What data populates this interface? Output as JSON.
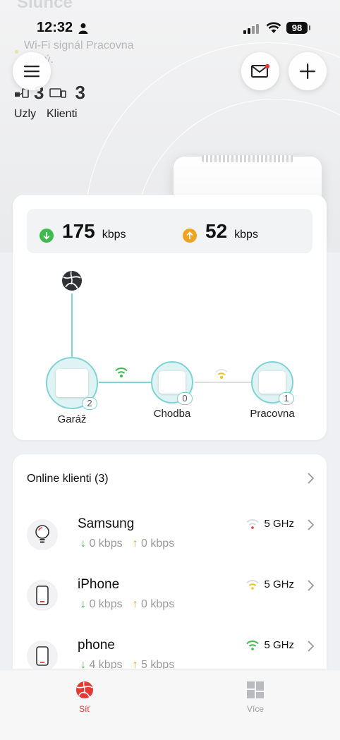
{
  "status_bar": {
    "time": "12:32",
    "battery": "98"
  },
  "header": {
    "title": "Slunce",
    "warning": "Wi-Fi signál Pracovna slabý.",
    "nodes_count": "3",
    "clients_count": "3",
    "nodes_label": "Uzly",
    "clients_label": "Klienti"
  },
  "speed": {
    "down_value": "175",
    "down_unit": "kbps",
    "up_value": "52",
    "up_unit": "kbps"
  },
  "topology": {
    "nodes": [
      {
        "name": "Garáž",
        "clients": "2"
      },
      {
        "name": "Chodba",
        "clients": "0"
      },
      {
        "name": "Pracovna",
        "clients": "1"
      }
    ]
  },
  "clients": {
    "header": "Online klienti (3)",
    "items": [
      {
        "name": "Samsung",
        "down": "0 kbps",
        "up": "0 kbps",
        "band": "5 GHz",
        "signal_color": "#e53935",
        "icon": "bulb-icon"
      },
      {
        "name": "iPhone",
        "down": "0 kbps",
        "up": "0 kbps",
        "band": "5 GHz",
        "signal_color": "#f0c419",
        "icon": "phone-icon"
      },
      {
        "name": "phone",
        "down": "4 kbps",
        "up": "5 kbps",
        "band": "5 GHz",
        "signal_color": "#3dbb4c",
        "icon": "phone-icon"
      }
    ]
  },
  "tabs": {
    "network_label": "Síť",
    "more_label": "Více"
  },
  "colors": {
    "accent_red": "#e53935",
    "teal": "#7fd3d3",
    "down_green": "#3dbb4c",
    "up_orange": "#f0a31e"
  }
}
